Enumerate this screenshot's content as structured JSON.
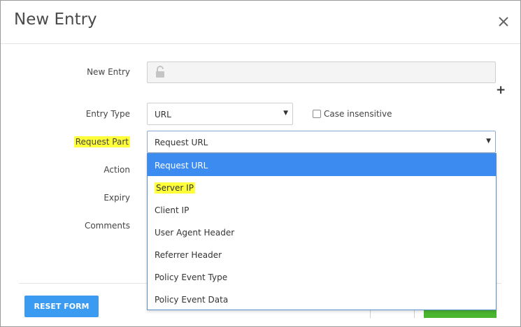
{
  "dialog": {
    "title": "New Entry"
  },
  "form": {
    "new_entry": {
      "label": "New Entry",
      "value": ""
    },
    "entry_type": {
      "label": "Entry Type",
      "selected": "URL"
    },
    "case_insensitive": {
      "label": "Case insensitive",
      "checked": false
    },
    "request_part": {
      "label": "Request Part",
      "selected": "Request URL"
    },
    "action": {
      "label": "Action"
    },
    "expiry": {
      "label": "Expiry"
    },
    "comments": {
      "label": "Comments"
    }
  },
  "dropdown": {
    "options": [
      {
        "label": "Request URL"
      },
      {
        "label": "Server IP"
      },
      {
        "label": "Client IP"
      },
      {
        "label": "User Agent Header"
      },
      {
        "label": "Referrer Header"
      },
      {
        "label": "Policy Event Type"
      },
      {
        "label": "Policy Event Data"
      }
    ],
    "selected_index": 0
  },
  "footer": {
    "reset_label": "RESET FORM"
  },
  "icons": {
    "close": "close-icon",
    "lock": "lock-icon",
    "plus": "plus-icon",
    "caret": "caret-down-icon"
  },
  "colors": {
    "accent": "#3a9bf0",
    "selected": "#3c8bf0",
    "highlight": "#ffff3a",
    "save": "#4ab52f"
  }
}
